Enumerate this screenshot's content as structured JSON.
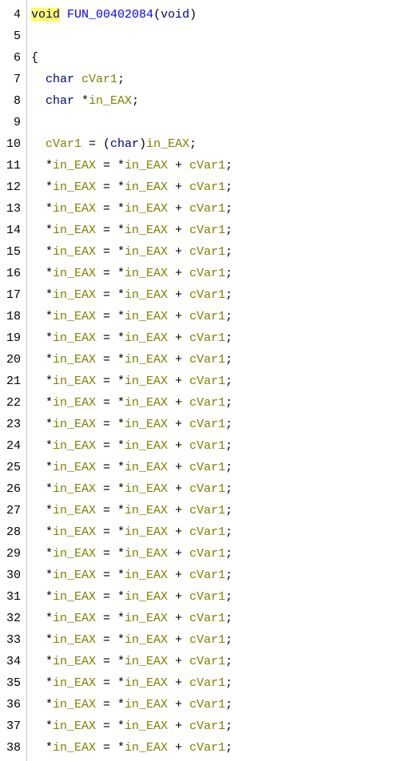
{
  "lines": [
    {
      "n": "4",
      "tokens": [
        {
          "t": "void",
          "c": "kw",
          "hl": true
        },
        {
          "t": " ",
          "c": "punc"
        },
        {
          "t": "FUN_00402084",
          "c": "fn"
        },
        {
          "t": "(",
          "c": "punc"
        },
        {
          "t": "void",
          "c": "kw"
        },
        {
          "t": ")",
          "c": "punc"
        }
      ]
    },
    {
      "n": "5",
      "tokens": []
    },
    {
      "n": "6",
      "tokens": [
        {
          "t": "{",
          "c": "punc"
        }
      ]
    },
    {
      "n": "7",
      "tokens": [
        {
          "t": "  ",
          "c": "punc"
        },
        {
          "t": "char",
          "c": "kw"
        },
        {
          "t": " ",
          "c": "punc"
        },
        {
          "t": "cVar1",
          "c": "var"
        },
        {
          "t": ";",
          "c": "punc"
        }
      ]
    },
    {
      "n": "8",
      "tokens": [
        {
          "t": "  ",
          "c": "punc"
        },
        {
          "t": "char",
          "c": "kw"
        },
        {
          "t": " *",
          "c": "punc"
        },
        {
          "t": "in_EAX",
          "c": "var"
        },
        {
          "t": ";",
          "c": "punc"
        }
      ]
    },
    {
      "n": "9",
      "tokens": []
    },
    {
      "n": "10",
      "tokens": [
        {
          "t": "  ",
          "c": "punc"
        },
        {
          "t": "cVar1",
          "c": "var"
        },
        {
          "t": " = (",
          "c": "punc"
        },
        {
          "t": "char",
          "c": "kw"
        },
        {
          "t": ")",
          "c": "punc"
        },
        {
          "t": "in_EAX",
          "c": "var"
        },
        {
          "t": ";",
          "c": "punc"
        }
      ]
    },
    {
      "n": "11",
      "repeat": true
    },
    {
      "n": "12",
      "repeat": true
    },
    {
      "n": "13",
      "repeat": true
    },
    {
      "n": "14",
      "repeat": true
    },
    {
      "n": "15",
      "repeat": true
    },
    {
      "n": "16",
      "repeat": true
    },
    {
      "n": "17",
      "repeat": true
    },
    {
      "n": "18",
      "repeat": true
    },
    {
      "n": "19",
      "repeat": true
    },
    {
      "n": "20",
      "repeat": true
    },
    {
      "n": "21",
      "repeat": true
    },
    {
      "n": "22",
      "repeat": true
    },
    {
      "n": "23",
      "repeat": true
    },
    {
      "n": "24",
      "repeat": true
    },
    {
      "n": "25",
      "repeat": true
    },
    {
      "n": "26",
      "repeat": true
    },
    {
      "n": "27",
      "repeat": true
    },
    {
      "n": "28",
      "repeat": true
    },
    {
      "n": "29",
      "repeat": true
    },
    {
      "n": "30",
      "repeat": true
    },
    {
      "n": "31",
      "repeat": true
    },
    {
      "n": "32",
      "repeat": true
    },
    {
      "n": "33",
      "repeat": true
    },
    {
      "n": "34",
      "repeat": true
    },
    {
      "n": "35",
      "repeat": true
    },
    {
      "n": "36",
      "repeat": true
    },
    {
      "n": "37",
      "repeat": true
    },
    {
      "n": "38",
      "repeat": true
    }
  ],
  "repeat_tokens": [
    {
      "t": "  *",
      "c": "punc"
    },
    {
      "t": "in_EAX",
      "c": "var"
    },
    {
      "t": " = *",
      "c": "punc"
    },
    {
      "t": "in_EAX",
      "c": "var"
    },
    {
      "t": " + ",
      "c": "punc"
    },
    {
      "t": "cVar1",
      "c": "var"
    },
    {
      "t": ";",
      "c": "punc"
    }
  ],
  "colors": {
    "keyword": "#000080",
    "function": "#0000ff",
    "variable": "#808000",
    "highlight": "#ffff66"
  }
}
